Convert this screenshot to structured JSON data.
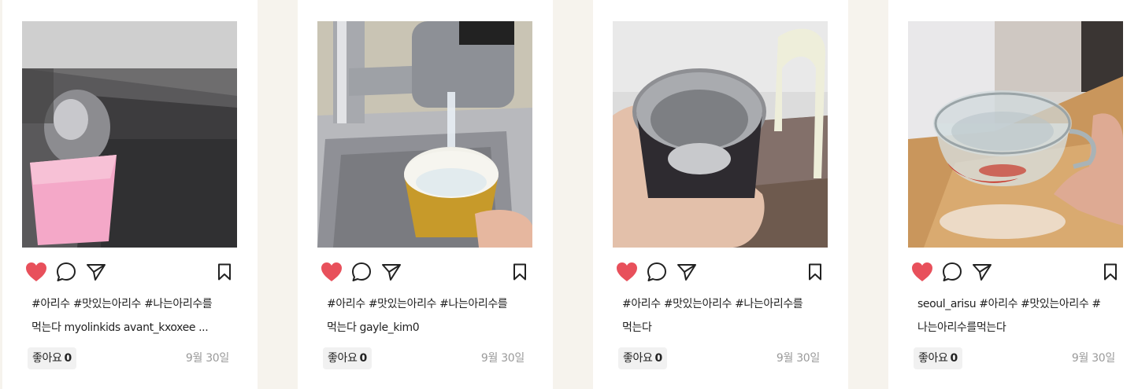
{
  "colors": {
    "heart": "#e8505b",
    "icon_stroke": "#222222",
    "muted": "#9a9a9a",
    "page_bg": "#f6f3ed"
  },
  "icons": {
    "like": "heart-icon",
    "comment": "speech-bubble-icon",
    "share": "paper-plane-icon",
    "save": "bookmark-icon"
  },
  "posts": [
    {
      "photo": "pink cup under faucet",
      "caption_line1": "#아리수 #맛있는아리수 #나는아리수를",
      "caption_line2": "먹는다 myolinkids avant_kxoxee ...",
      "likes_label": "좋아요",
      "likes_count": "0",
      "date": "9월 30일"
    },
    {
      "photo": "mug filling at kitchen sink",
      "caption_line1": "#아리수 #맛있는아리수 #나는아리수를",
      "caption_line2": "먹는다 gayle_kim0",
      "likes_label": "좋아요",
      "likes_count": "0",
      "date": "9월 30일"
    },
    {
      "photo": "steel cup of water in hand",
      "caption_line1": "#아리수 #맛있는아리수 #나는아리수를",
      "caption_line2": "먹는다",
      "likes_label": "좋아요",
      "likes_count": "0",
      "date": "9월 30일"
    },
    {
      "photo": "glass cup of water in hand",
      "caption_line1": "seoul_arisu #아리수 #맛있는아리수 #",
      "caption_line2": "나는아리수를먹는다",
      "likes_label": "좋아요",
      "likes_count": "0",
      "date": "9월 30일"
    }
  ]
}
